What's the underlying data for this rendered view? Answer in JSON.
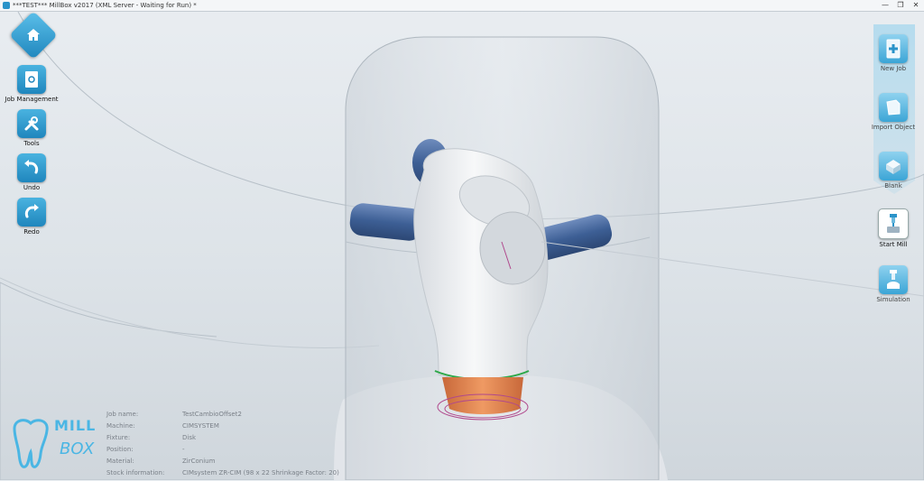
{
  "window": {
    "title": "***TEST*** MillBox v2017 (XML Server - Waiting for Run) *",
    "minimize_glyph": "—",
    "maximize_glyph": "❐",
    "close_glyph": "✕"
  },
  "left_toolbar": {
    "home_icon": "home-icon",
    "items": [
      {
        "label": "Job Management",
        "icon": "job-management-icon"
      },
      {
        "label": "Tools",
        "icon": "tools-icon"
      },
      {
        "label": "Undo",
        "icon": "undo-icon"
      },
      {
        "label": "Redo",
        "icon": "redo-icon"
      }
    ]
  },
  "right_toolbar": {
    "items": [
      {
        "label": "New Job",
        "icon": "new-job-icon"
      },
      {
        "label": "Import Object",
        "icon": "import-object-icon"
      },
      {
        "label": "Blank",
        "icon": "blank-icon"
      },
      {
        "label": "Start Mill",
        "icon": "start-mill-icon",
        "active": true
      },
      {
        "label": "Simulation",
        "icon": "simulation-icon"
      }
    ]
  },
  "job_info": {
    "rows": [
      {
        "key": "Job name:",
        "value": "TestCambioOffset2"
      },
      {
        "key": "Machine:",
        "value": "CIMSYSTEM"
      },
      {
        "key": "Fixture:",
        "value": "Disk"
      },
      {
        "key": "Position:",
        "value": "-"
      },
      {
        "key": "Material:",
        "value": "ZirConium"
      },
      {
        "key": "Stock information:",
        "value": "CIMsystem ZR-CIM (98 x 22 Shrinkage Factor: 20)"
      }
    ]
  },
  "logo": {
    "line1": "MILL",
    "line2": "BOX"
  },
  "colors": {
    "accent": "#2a93c9",
    "abutment": "#f1f3f5",
    "connector": "#3d5f95",
    "base": "#e0834a",
    "margin_line": "#2ea84a"
  }
}
